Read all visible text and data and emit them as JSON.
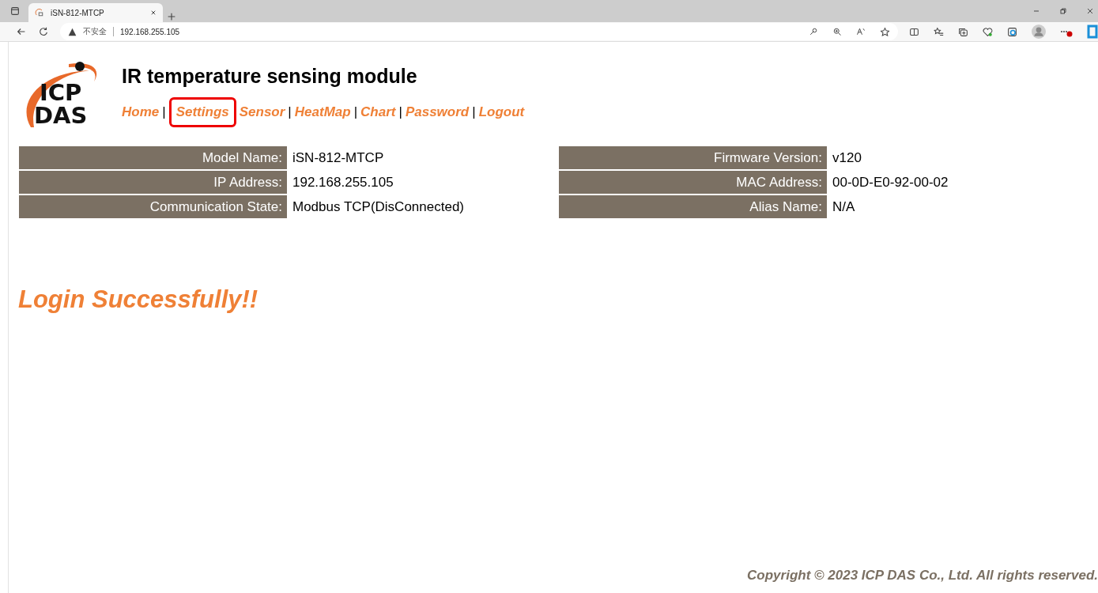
{
  "browser": {
    "tab": {
      "title": "iSN-812-MTCP"
    },
    "address": {
      "security": "不安全",
      "url": "192.168.255.105"
    }
  },
  "header": {
    "logo": [
      "ICP",
      "DAS"
    ],
    "title": "IR temperature sensing module"
  },
  "nav": [
    {
      "label": "Home",
      "highlighted": false
    },
    {
      "separator": "|",
      "label": "Settings",
      "highlighted": true
    },
    {
      "label": "Sensor",
      "highlighted": false
    },
    {
      "separator": "|",
      "label": "HeatMap",
      "highlighted": false
    },
    {
      "separator": "|",
      "label": "Chart",
      "highlighted": false
    },
    {
      "separator": "|",
      "label": "Password",
      "highlighted": false
    },
    {
      "separator": "|",
      "label": "Logout",
      "highlighted": false
    }
  ],
  "info": {
    "left": [
      {
        "label": "Model Name:",
        "value": "iSN-812-MTCP"
      },
      {
        "label": "IP Address:",
        "value": "192.168.255.105"
      },
      {
        "label": "Communication State:",
        "value": "Modbus TCP(DisConnected)"
      }
    ],
    "right": [
      {
        "label": "Firmware Version:",
        "value": "v120"
      },
      {
        "label": "MAC Address:",
        "value": "00-0D-E0-92-00-02"
      },
      {
        "label": "Alias Name:",
        "value": "N/A"
      }
    ]
  },
  "message": "Login Successfully!!",
  "footer": "Copyright © 2023 ICP DAS Co., Ltd. All rights reserved."
}
